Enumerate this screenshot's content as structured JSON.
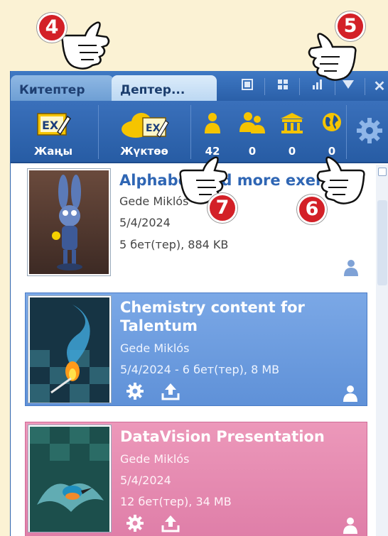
{
  "tabs": [
    {
      "label": "Китептер",
      "active": false
    },
    {
      "label": "Дептер...",
      "active": true
    }
  ],
  "window_controls": [
    "layout-single-icon",
    "grid-icon",
    "bars-icon",
    "dropdown-icon",
    "close-icon"
  ],
  "close_label": "✕",
  "toolbar": {
    "new_label": "Жаңы",
    "download_label": "Жүктөө",
    "counts": [
      {
        "icon": "user-icon",
        "value": "42"
      },
      {
        "icon": "group-icon",
        "value": "0"
      },
      {
        "icon": "institution-icon",
        "value": "0"
      },
      {
        "icon": "globe-icon",
        "value": "0"
      }
    ],
    "settings_icon": "gear-icon"
  },
  "documents": [
    {
      "title": "Alphabet and more exercises",
      "author": "Gede Miklós",
      "date": "5/4/2024",
      "info": "5 бет(тер), 884 KB",
      "style": "plain"
    },
    {
      "title_line1": "Chemistry content for",
      "title_line2": "Talentum",
      "author": "Gede Miklós",
      "info": "5/4/2024 - 6 бет(тер), 8 MB",
      "style": "blue"
    },
    {
      "title": "DataVision Presentation",
      "author": "Gede Miklós",
      "date": "5/4/2024",
      "info": "12 бет(тер), 34 MB",
      "style": "pink"
    }
  ],
  "callouts": [
    "4",
    "5",
    "6",
    "7"
  ],
  "colors": {
    "background": "#fbf2d4",
    "toolbar": "#2f66b0",
    "blue_item": "#6f9ee0",
    "pink_item": "#e58bb0",
    "callout": "#d32027"
  }
}
